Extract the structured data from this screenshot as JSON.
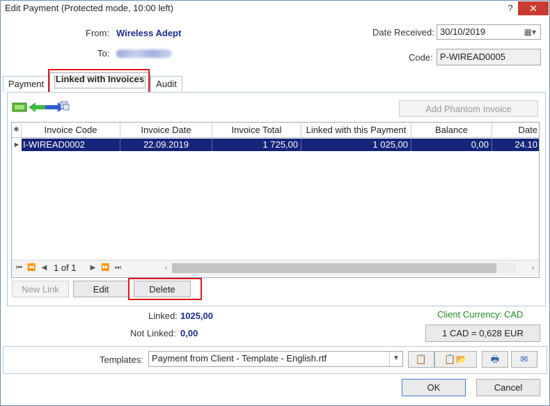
{
  "window": {
    "title": "Edit Payment (Protected mode, 10:00 left)",
    "help": "?",
    "close": "✕"
  },
  "header": {
    "from_label": "From:",
    "from_value": "Wireless Adept",
    "to_label": "To:",
    "date_label": "Date Received:",
    "date_value": "30/10/2019",
    "code_label": "Code:",
    "code_value": "P-WIREAD0005"
  },
  "tabs": [
    {
      "label": "Payment"
    },
    {
      "label": "Linked with Invoices"
    },
    {
      "label": "Audit"
    }
  ],
  "panel": {
    "add_phantom": "Add Phantom Invoice",
    "columns": [
      "Invoice Code",
      "Invoice Date",
      "Invoice Total",
      "Linked with this Payment",
      "Balance",
      "Date"
    ],
    "rows": [
      {
        "code": "I-WIREAD0002",
        "date": "22.09.2019",
        "total": "1 725,00",
        "linked": "1 025,00",
        "balance": "0,00",
        "date2": "24.10"
      }
    ],
    "pager": "1 of 1",
    "new_link": "New Link",
    "edit": "Edit",
    "delete": "Delete"
  },
  "summary": {
    "linked_label": "Linked:",
    "linked_value": "1025,00",
    "not_linked_label": "Not Linked:",
    "not_linked_value": "0,00",
    "currency_label": "Client Currency:",
    "currency_value": "CAD",
    "rate": "1 CAD = 0,628 EUR"
  },
  "templates": {
    "label": "Templates:",
    "selected": "Payment from Client - Template - English.rtf"
  },
  "footer": {
    "ok": "OK",
    "cancel": "Cancel"
  },
  "colors": {
    "selection": "#16257a",
    "highlight": "#e0181b",
    "accent_text": "#1a2c8a",
    "currency_green": "#1f8a1f"
  }
}
